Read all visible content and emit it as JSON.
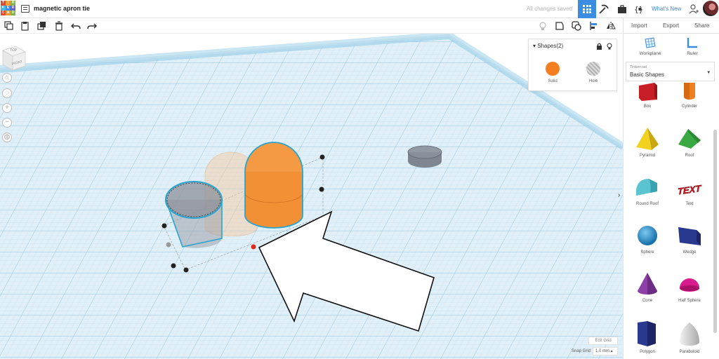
{
  "app": {
    "logo_letters": [
      "T",
      "I",
      "N",
      "K",
      "E",
      "R",
      "C",
      "A",
      "D"
    ],
    "logo_colors": [
      "#e2492f",
      "#f09935",
      "#7ab648",
      "#46b4e7",
      "#3a8de0",
      "#6c5ec5",
      "#e2492f",
      "#f09935",
      "#7ab648"
    ],
    "design_title": "magnetic apron tie",
    "save_status": "All changes saved",
    "whats_new": "What's New"
  },
  "toolbar": {
    "import": "Import",
    "export": "Export",
    "share": "Share"
  },
  "shapes_panel": {
    "header": "Shapes(2)",
    "solid_label": "Solid",
    "hole_label": "Hole",
    "solid_color": "#f47f20"
  },
  "viewcube": {
    "top": "TOP",
    "front": "FRONT"
  },
  "right_panel": {
    "workplane": "Workplane",
    "ruler": "Ruler",
    "library_small": "Tinkercad",
    "library": "Basic Shapes",
    "shapes": [
      {
        "name": "box",
        "label": "Box",
        "color": "#d42027"
      },
      {
        "name": "cylinder",
        "label": "Cylinder",
        "color": "#f47f20"
      },
      {
        "name": "pyramid",
        "label": "Pyramid",
        "color": "#f2d21f"
      },
      {
        "name": "roof",
        "label": "Roof",
        "color": "#3aa843"
      },
      {
        "name": "round-roof",
        "label": "Round Roof",
        "color": "#5cc4d1"
      },
      {
        "name": "text",
        "label": "Text",
        "color": "#d42027"
      },
      {
        "name": "sphere",
        "label": "Sphere",
        "color": "#1f8fd0"
      },
      {
        "name": "wedge",
        "label": "Wedge",
        "color": "#2a3990"
      },
      {
        "name": "cone",
        "label": "Cone",
        "color": "#8e3fa8"
      },
      {
        "name": "half-sphere",
        "label": "Half Sphere",
        "color": "#d81b8c"
      },
      {
        "name": "polygon",
        "label": "Polygon",
        "color": "#2a3990"
      },
      {
        "name": "paraboloid",
        "label": "Paraboloid",
        "color": "#d0d0d0"
      }
    ],
    "text_shape_glyph": "TEXT"
  },
  "grid": {
    "edit_grid": "Edit Grid",
    "snap_grid": "Snap Grid",
    "snap_value": "1.0 mm"
  }
}
